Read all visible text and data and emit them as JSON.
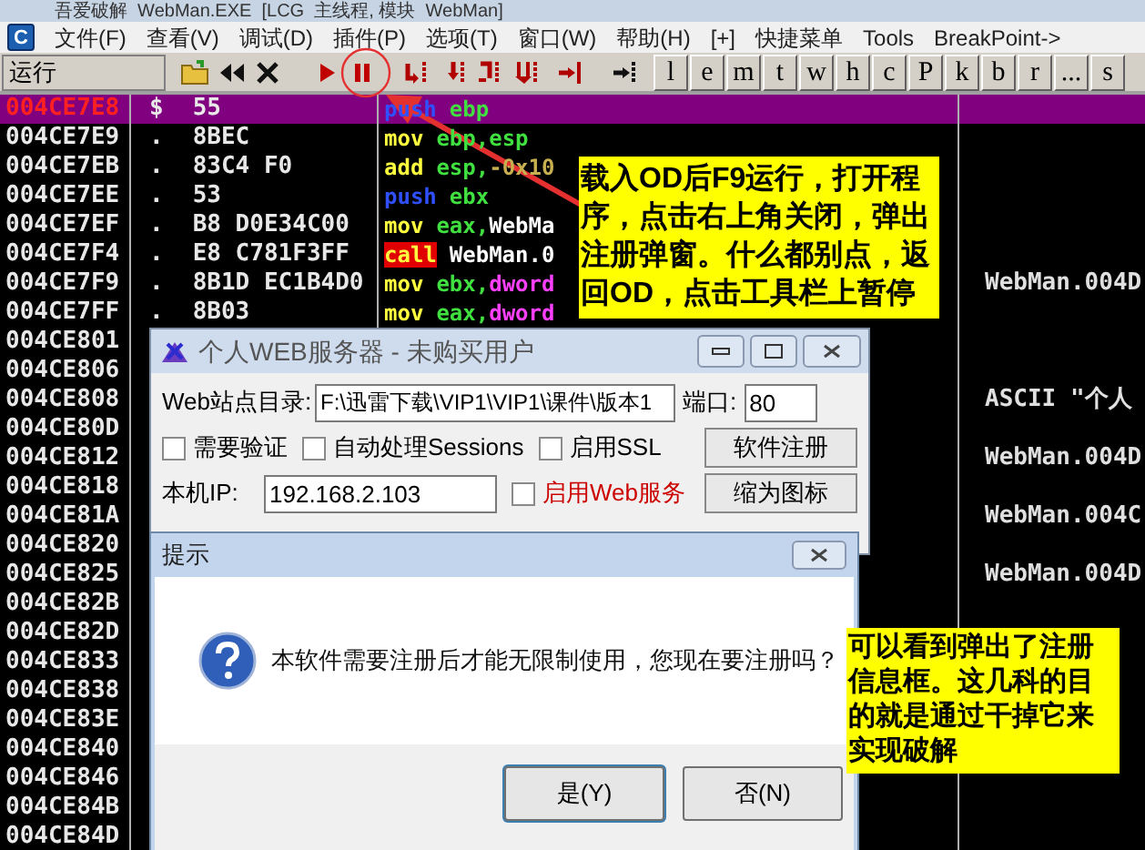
{
  "window": {
    "title": "吾爱破解  WebMan.EXE  [LCG  主线程, 模块  WebMan]"
  },
  "menu_bar": {
    "logo": "C",
    "items": [
      "文件(F)",
      "查看(V)",
      "调试(D)",
      "插件(P)",
      "选项(T)",
      "窗口(W)",
      "帮助(H)",
      "[+]",
      "快捷菜单",
      "Tools",
      "BreakPoint->"
    ]
  },
  "toolbar": {
    "status": "运行",
    "letter_buttons": [
      "l",
      "e",
      "m",
      "t",
      "w",
      "h",
      "c",
      "P",
      "k",
      "b",
      "r",
      "...",
      "s"
    ]
  },
  "disassembly": {
    "rows": [
      {
        "address": "004CE7E8",
        "marker": "$",
        "hex": "55",
        "command": [
          {
            "text": "push",
            "kind": "stack"
          },
          {
            "text": "ebp",
            "kind": "reg"
          }
        ],
        "comment": "",
        "selected": true
      },
      {
        "address": "004CE7E9",
        "marker": ".",
        "hex": "8BEC",
        "command": [
          {
            "text": "mov",
            "kind": "move"
          },
          {
            "text": "ebp",
            "kind": "reg"
          },
          {
            "text": ",",
            "kind": "punct"
          },
          {
            "text": "esp",
            "kind": "reg"
          }
        ],
        "comment": "",
        "selected": false
      },
      {
        "address": "004CE7EB",
        "marker": ".",
        "hex": "83C4 F0",
        "command": [
          {
            "text": "add",
            "kind": "move"
          },
          {
            "text": "esp",
            "kind": "reg"
          },
          {
            "text": ",",
            "kind": "punct"
          },
          {
            "text": "-0x10",
            "kind": "const"
          }
        ],
        "comment": "",
        "selected": false
      },
      {
        "address": "004CE7EE",
        "marker": ".",
        "hex": "53",
        "command": [
          {
            "text": "push",
            "kind": "stack"
          },
          {
            "text": "ebx",
            "kind": "reg"
          }
        ],
        "comment": "",
        "selected": false
      },
      {
        "address": "004CE7EF",
        "marker": ".",
        "hex": "B8 D0E34C00",
        "command": [
          {
            "text": "mov",
            "kind": "move"
          },
          {
            "text": "eax",
            "kind": "reg"
          },
          {
            "text": ",",
            "kind": "punct"
          },
          {
            "text": "WebMa",
            "kind": "name"
          }
        ],
        "comment": "",
        "selected": false
      },
      {
        "address": "004CE7F4",
        "marker": ".",
        "hex": "E8 C781F3FF",
        "command": [
          {
            "text": "call",
            "kind": "call"
          },
          {
            "text": "WebMan.0",
            "kind": "name"
          }
        ],
        "comment": "",
        "selected": false
      },
      {
        "address": "004CE7F9",
        "marker": ".",
        "hex": "8B1D EC1B4D0",
        "command": [
          {
            "text": "mov",
            "kind": "move"
          },
          {
            "text": "ebx",
            "kind": "reg"
          },
          {
            "text": ",",
            "kind": "punct"
          },
          {
            "text": "dword",
            "kind": "mem"
          }
        ],
        "comment": "WebMan.004D",
        "selected": false
      },
      {
        "address": "004CE7FF",
        "marker": ".",
        "hex": "8B03",
        "command": [
          {
            "text": "mov",
            "kind": "move"
          },
          {
            "text": "eax",
            "kind": "reg"
          },
          {
            "text": ",",
            "kind": "punct"
          },
          {
            "text": "dword",
            "kind": "mem"
          }
        ],
        "comment": "",
        "selected": false
      },
      {
        "address": "004CE801",
        "marker": "",
        "hex": "",
        "command": [],
        "comment": "",
        "selected": false
      },
      {
        "address": "004CE806",
        "marker": "",
        "hex": "",
        "command": [],
        "comment": "",
        "selected": false
      },
      {
        "address": "004CE808",
        "marker": "",
        "hex": "",
        "command": [],
        "comment": "ASCII \"个人",
        "selected": false
      },
      {
        "address": "004CE80D",
        "marker": "",
        "hex": "",
        "command": [],
        "comment": "",
        "selected": false
      },
      {
        "address": "004CE812",
        "marker": "",
        "hex": "",
        "command": [],
        "comment": "WebMan.004D",
        "selected": false
      },
      {
        "address": "004CE818",
        "marker": "",
        "hex": "",
        "command": [],
        "comment": "",
        "selected": false
      },
      {
        "address": "004CE81A",
        "marker": "",
        "hex": "",
        "command": [],
        "comment": "WebMan.004C",
        "selected": false
      },
      {
        "address": "004CE820",
        "marker": "",
        "hex": "",
        "command": [],
        "comment": "",
        "selected": false
      },
      {
        "address": "004CE825",
        "marker": "",
        "hex": "",
        "command": [],
        "comment": "WebMan.004D",
        "selected": false
      },
      {
        "address": "004CE82B",
        "marker": "",
        "hex": "",
        "command": [],
        "comment": "",
        "selected": false
      },
      {
        "address": "004CE82D",
        "marker": "",
        "hex": "",
        "command": [],
        "comment": "",
        "selected": false
      },
      {
        "address": "004CE833",
        "marker": "",
        "hex": "",
        "command": [],
        "comment": "",
        "selected": false
      },
      {
        "address": "004CE838",
        "marker": "",
        "hex": "",
        "command": [],
        "comment": "",
        "selected": false
      },
      {
        "address": "004CE83E",
        "marker": "",
        "hex": "",
        "command": [],
        "comment": "",
        "selected": false
      },
      {
        "address": "004CE840",
        "marker": "",
        "hex": "",
        "command": [],
        "comment": "",
        "selected": false
      },
      {
        "address": "004CE846",
        "marker": "",
        "hex": "",
        "command": [],
        "comment": "",
        "selected": false
      },
      {
        "address": "004CE84B",
        "marker": "",
        "hex": "",
        "command": [],
        "comment": "",
        "selected": false
      },
      {
        "address": "004CE84D",
        "marker": "",
        "hex": "",
        "command": [],
        "comment": "",
        "selected": false
      }
    ]
  },
  "web_server_window": {
    "title": "个人WEB服务器 - 未购买用户",
    "site_dir_label": "Web站点目录:",
    "site_dir": "F:\\迅雷下载\\VIP1\\VIP1\\课件\\版本1",
    "port_label": "端口:",
    "port": "80",
    "checkboxes": [
      {
        "label": "需要验证",
        "checked": false
      },
      {
        "label": "自动处理Sessions",
        "checked": false
      },
      {
        "label": "启用SSL",
        "checked": false
      },
      {
        "label": "启用Web服务",
        "checked": false,
        "color": "#cc0000"
      }
    ],
    "ip_label": "本机IP:",
    "ip": "192.168.2.103",
    "buttons": [
      "软件注册",
      "缩为图标"
    ]
  },
  "dialog": {
    "title": "提示",
    "message": "本软件需要注册后才能无限制使用，您现在要注册吗？",
    "buttons": [
      "是(Y)",
      "否(N)"
    ]
  },
  "notes": [
    {
      "text": "载入OD后F9运行，打开程序，点击右上角关闭，弹出注册弹窗。什么都别点，返回OD，点击工具栏上暂停"
    },
    {
      "text": "可以看到弹出了注册信息框。这几科的目的就是通过干掉它来实现破解"
    }
  ]
}
